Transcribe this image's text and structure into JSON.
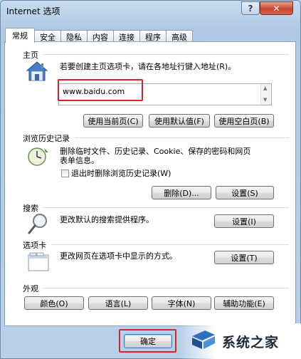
{
  "window": {
    "title": "Internet 选项",
    "help": "?",
    "close": "✕"
  },
  "tabs": [
    "常规",
    "安全",
    "隐私",
    "内容",
    "连接",
    "程序",
    "高级"
  ],
  "homepage": {
    "label": "主页",
    "description": "若要创建主页选项卡，请在各地址行键入地址(R)。",
    "url": "www.baidu.com",
    "buttons": [
      "使用当前页(C)",
      "使用默认值(F)",
      "使用空白页(B)"
    ]
  },
  "history": {
    "label": "浏览历史记录",
    "description_line1": "删除临时文件、历史记录、Cookie、保存的密码和网页",
    "description_line2": "表单信息。",
    "checkbox_label": "退出时删除浏览历史记录(W)",
    "delete_button": "删除(D)...",
    "settings_button": "设置(S)"
  },
  "search": {
    "label": "搜索",
    "description": "更改默认的搜索提供程序。",
    "settings_button": "设置(I)"
  },
  "tabsection": {
    "label": "选项卡",
    "description": "更改网页在选项卡中显示的方式。",
    "settings_button": "设置(T)"
  },
  "appearance": {
    "label": "外观",
    "buttons": [
      "颜色(O)",
      "语言(L)",
      "字体(N)",
      "辅助功能(E)"
    ]
  },
  "footer": {
    "ok_button": "确定"
  },
  "watermark": {
    "text": "系统之家"
  }
}
